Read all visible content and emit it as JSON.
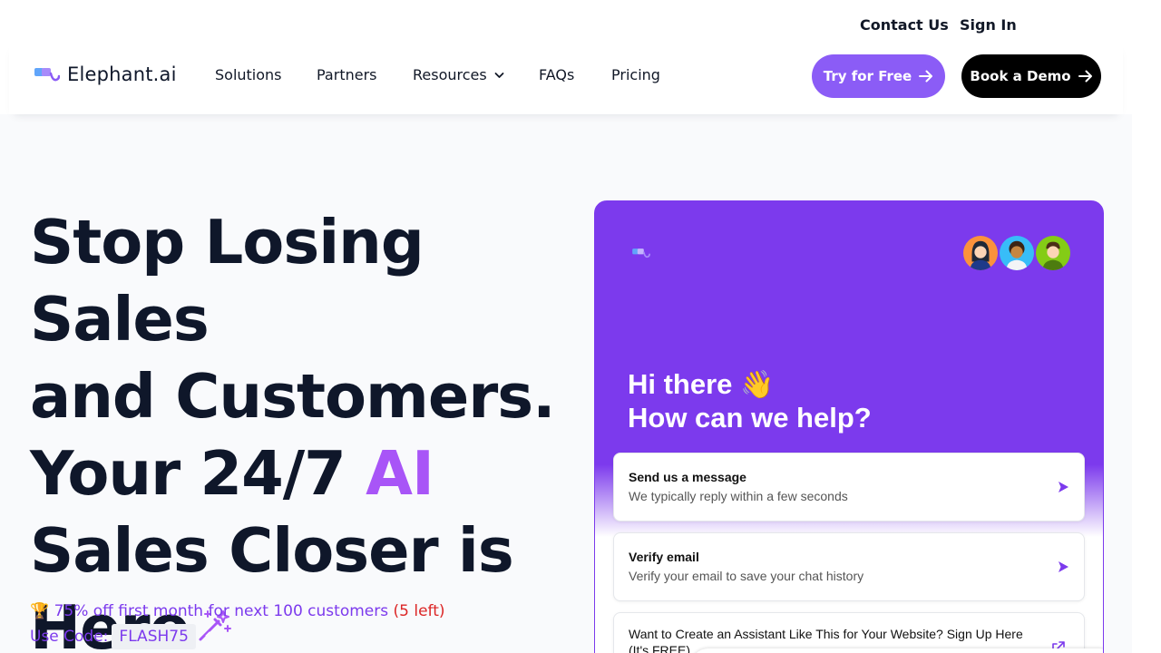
{
  "topbar": {
    "contact_label": "Contact Us",
    "signin_label": "Sign In"
  },
  "brand": {
    "name": "Elephant.ai",
    "accent_color": "#8b5cf6"
  },
  "nav": {
    "items": [
      {
        "label": "Solutions"
      },
      {
        "label": "Partners"
      },
      {
        "label": "Resources",
        "icon": "chevron-down-icon"
      },
      {
        "label": "FAQs"
      },
      {
        "label": "Pricing"
      }
    ],
    "try_label": "Try for Free",
    "demo_label": "Book a Demo"
  },
  "hero": {
    "line1": "Stop Losing Sales",
    "line2": "and Customers.",
    "line3_prefix": "Your 24/7 ",
    "line3_highlight": "AI",
    "line4": "Sales Closer is",
    "line5": "Here",
    "icon": "magic-wand-icon"
  },
  "promo": {
    "emoji": "🏆",
    "text": "75% off first month for next 100 customers",
    "left": "(5 left)",
    "code_label": "Use Code:",
    "code": "FLASH75"
  },
  "chat": {
    "greeting_line1": "Hi there",
    "greeting_emoji": "👋",
    "greeting_line2": "How can we help?",
    "cards": [
      {
        "title": "Send us a message",
        "subtitle": "We typically reply within a few seconds"
      },
      {
        "title": "Verify email",
        "subtitle": "Verify your email to save your chat history"
      },
      {
        "text": "Want to Create an Assistant Like This for Your Website? Sign Up Here (It's FREE)"
      }
    ]
  }
}
